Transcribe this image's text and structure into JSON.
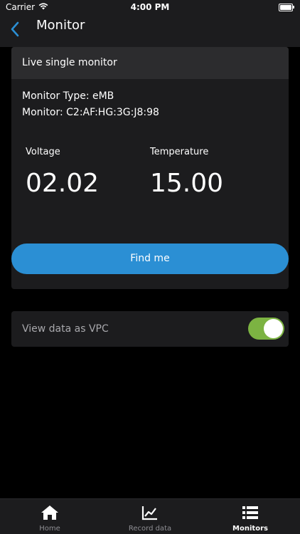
{
  "status_bar": {
    "carrier": "Carrier",
    "time": "4:00 PM"
  },
  "nav": {
    "title": "Monitor",
    "back_icon": "chevron-left-icon",
    "accent_color": "#2b8fd4"
  },
  "card": {
    "header": "Live single monitor",
    "monitor_type": "Monitor Type: eMB",
    "monitor_id": "Monitor: C2:AF:HG:3G:J8:98",
    "metrics": [
      {
        "label": "Voltage",
        "value": "02.02"
      },
      {
        "label": "Temperature",
        "value": "15.00"
      }
    ],
    "find_me_label": "Find me"
  },
  "vpc": {
    "label": "View data as VPC",
    "toggle_on": true,
    "toggle_color": "#7cb342"
  },
  "tab_bar": {
    "tabs": [
      {
        "label": "Home",
        "icon": "home-icon",
        "active": false
      },
      {
        "label": "Record data",
        "icon": "chart-icon",
        "active": false
      },
      {
        "label": "Monitors",
        "icon": "list-icon",
        "active": true
      }
    ]
  }
}
